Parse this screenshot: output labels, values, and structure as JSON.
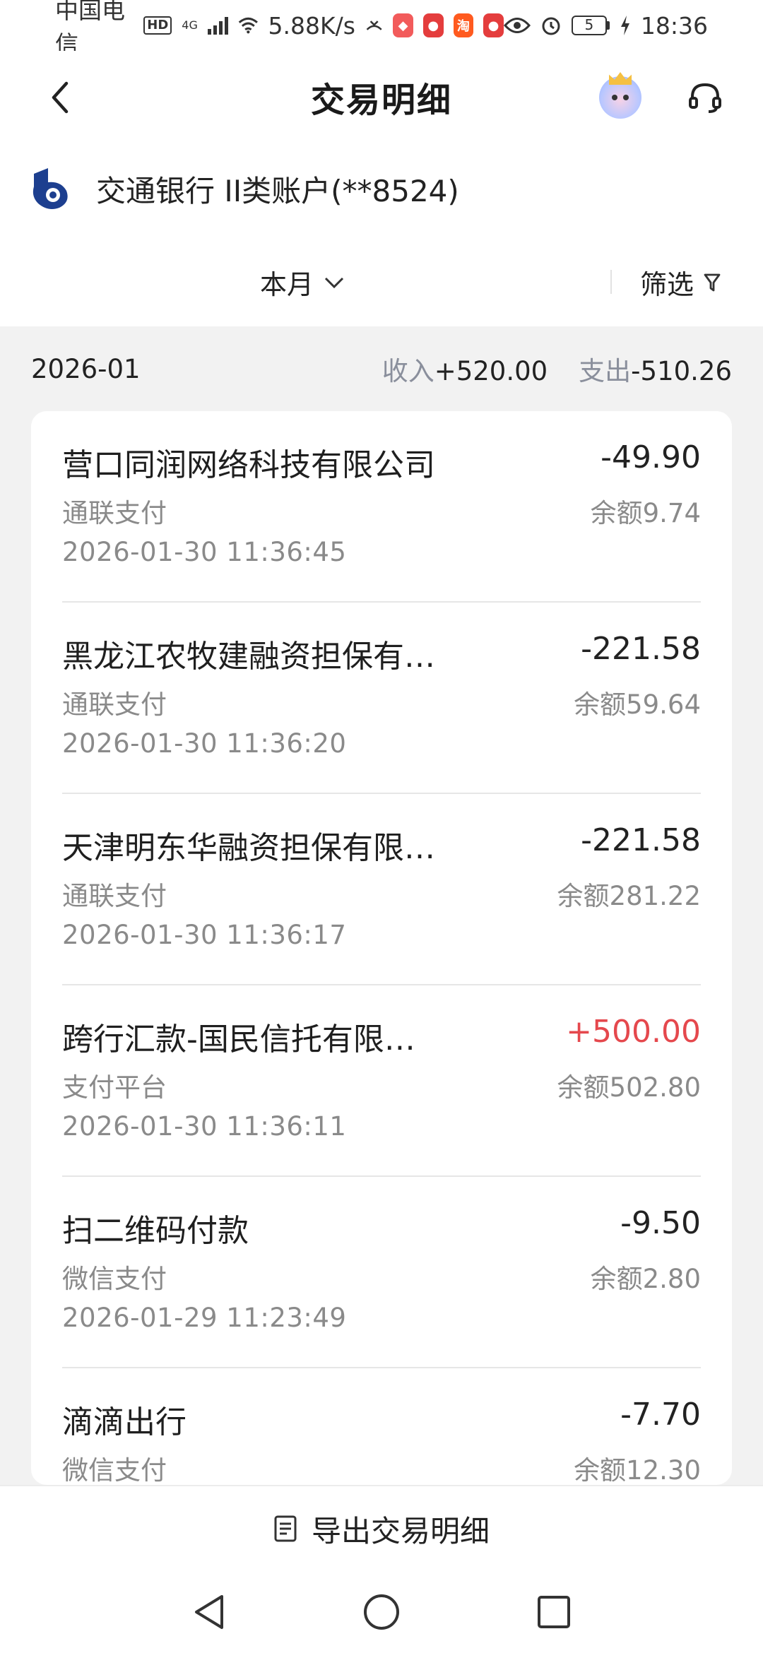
{
  "status_bar": {
    "carrier": "中国电信",
    "hd_badge": "HD",
    "network": "4G",
    "speed": "5.88K/s",
    "battery": "5",
    "time": "18:36"
  },
  "header": {
    "title": "交易明细"
  },
  "account": {
    "name": "交通银行 II类账户(**8524)"
  },
  "filter": {
    "period_label": "本月",
    "filter_label": "筛选"
  },
  "summary": {
    "month": "2026-01",
    "income_label": "收入",
    "income_value": "+520.00",
    "expense_label": "支出",
    "expense_value": "-510.26"
  },
  "transactions": [
    {
      "name": "营口同润网络科技有限公司",
      "amount": "-49.90",
      "channel": "通联支付",
      "balance": "余额9.74",
      "time": "2026-01-30 11:36:45",
      "type": "expense"
    },
    {
      "name": "黑龙江农牧建融资担保有…",
      "amount": "-221.58",
      "channel": "通联支付",
      "balance": "余额59.64",
      "time": "2026-01-30 11:36:20",
      "type": "expense"
    },
    {
      "name": "天津明东华融资担保有限…",
      "amount": "-221.58",
      "channel": "通联支付",
      "balance": "余额281.22",
      "time": "2026-01-30 11:36:17",
      "type": "expense"
    },
    {
      "name": "跨行汇款-国民信托有限…",
      "amount": "+500.00",
      "channel": "支付平台",
      "balance": "余额502.80",
      "time": "2026-01-30 11:36:11",
      "type": "income"
    },
    {
      "name": "扫二维码付款",
      "amount": "-9.50",
      "channel": "微信支付",
      "balance": "余额2.80",
      "time": "2026-01-29 11:23:49",
      "type": "expense"
    },
    {
      "name": "滴滴出行",
      "amount": "-7.70",
      "channel": "微信支付",
      "balance": "余额12.30",
      "time": "",
      "type": "expense"
    }
  ],
  "export": {
    "label": "导出交易明细"
  },
  "colors": {
    "income": "#e5484d",
    "muted": "#8a8a8a",
    "bank_blue": "#1d3f8f"
  }
}
